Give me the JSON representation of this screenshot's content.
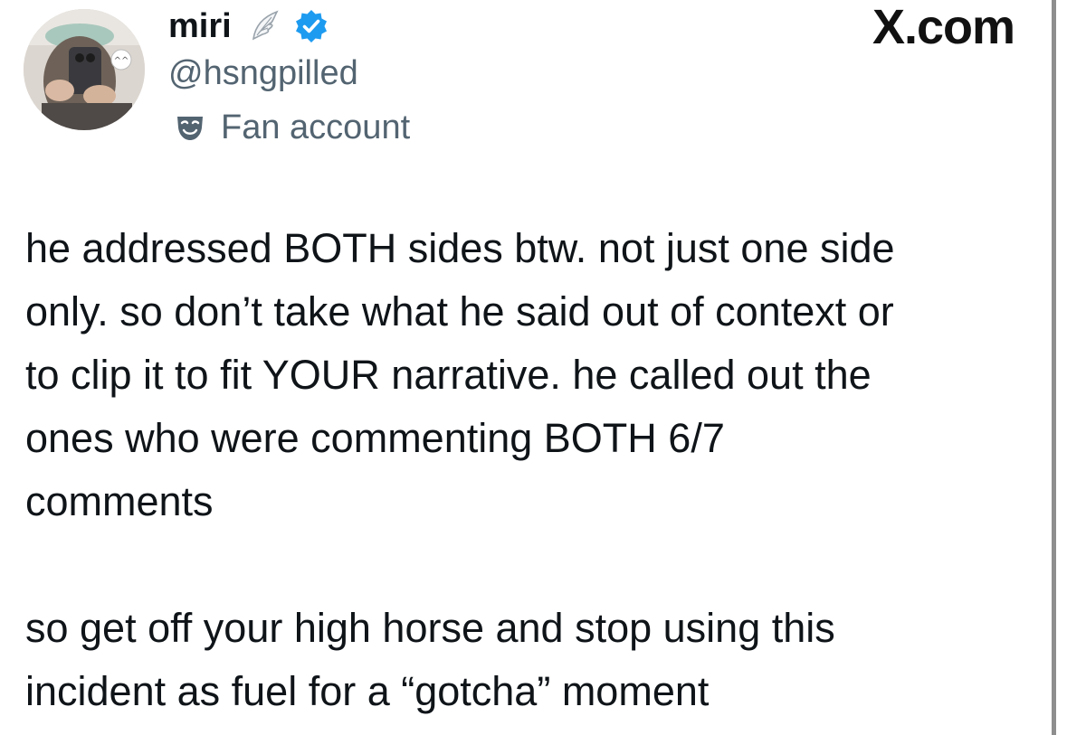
{
  "author": {
    "display_name": "miri",
    "handle": "@hsngpilled",
    "label": "Fan account",
    "verified": true,
    "icons": [
      "wing-icon",
      "verified-badge-icon",
      "mask-icon"
    ],
    "accent_color": "#1d9bf0"
  },
  "watermark": "X.com",
  "tweet": {
    "paragraph_1": [
      "he addressed BOTH sides btw. not just one side",
      "only. so don’t take what he said out of context or",
      "to clip it to fit YOUR narrative. he called out the",
      "ones who were commenting BOTH 6/7",
      "comments"
    ],
    "paragraph_2": [
      "so get off your high horse and stop using this",
      "incident as fuel for a “gotcha” moment"
    ]
  }
}
